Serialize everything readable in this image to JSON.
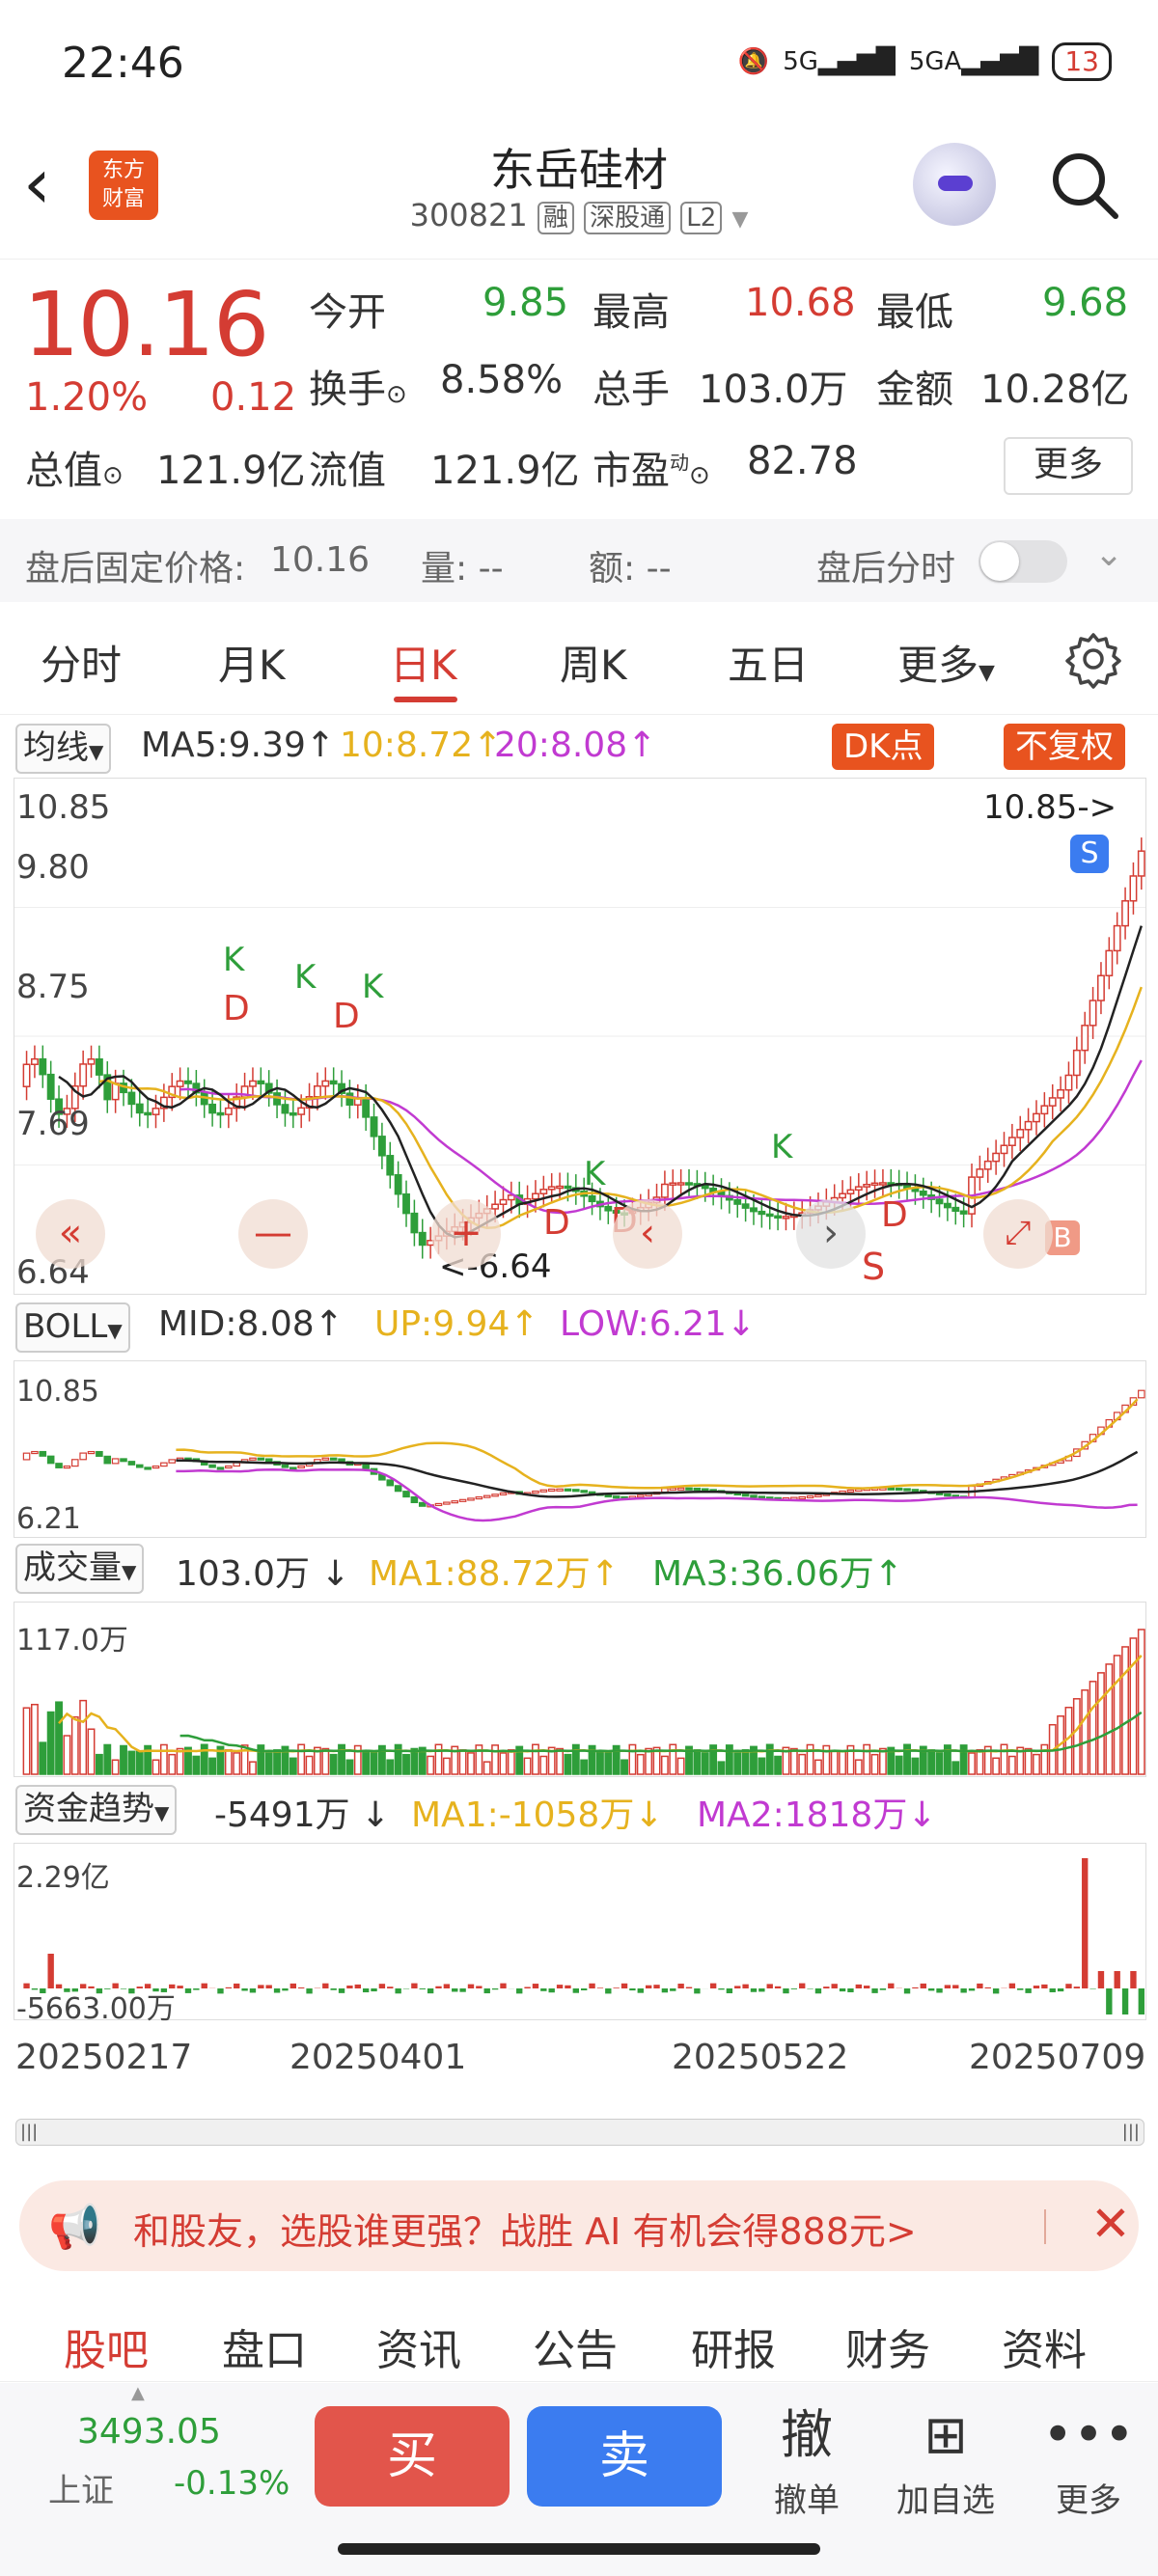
{
  "status_bar": {
    "time": "22:46",
    "network1": "5G",
    "network2": "5GA",
    "battery": "13"
  },
  "header": {
    "brand_logo_line1": "东方",
    "brand_logo_line2": "财富",
    "stock_name": "东岳硅材",
    "stock_code": "300821",
    "tags": [
      "融",
      "深股通",
      "L2"
    ]
  },
  "quote": {
    "price": "10.16",
    "change_pct": "1.20%",
    "change_amt": "0.12",
    "fields": {
      "open_label": "今开",
      "open_value": "9.85",
      "high_label": "最高",
      "high_value": "10.68",
      "low_label": "最低",
      "low_value": "9.68",
      "turnover_label": "换手",
      "turnover_value": "8.58%",
      "volume_label": "总手",
      "volume_value": "103.0万",
      "amount_label": "金额",
      "amount_value": "10.28亿",
      "mktcap_label": "总值",
      "mktcap_value": "121.9亿",
      "float_label": "流值",
      "float_value": "121.9亿",
      "pe_label": "市盈",
      "pe_sup": "动",
      "pe_value": "82.78"
    },
    "more_label": "更多"
  },
  "after_hours": {
    "price_label": "盘后固定价格:",
    "price_value": "10.16",
    "volume_label": "量: --",
    "amount_label": "额: --",
    "toggle_label": "盘后分时",
    "toggle_on": false
  },
  "period_tabs": [
    "分时",
    "月K",
    "日K",
    "周K",
    "五日",
    "更多"
  ],
  "period_active": "日K",
  "ma_row": {
    "selector": "均线",
    "ma5": "MA5:9.39",
    "ma10": "10:8.72",
    "ma20": "20:8.08",
    "dk_label": "DK点",
    "fq_label": "不复权"
  },
  "kline_labels": {
    "high": "10.85",
    "l2": "9.80",
    "l3": "8.75",
    "l4": "7.69",
    "low": "6.64",
    "high_marker": "10.85->",
    "low_marker": "<-6.64",
    "signal_k": "K",
    "signal_d": "D",
    "signal_s": "S",
    "signal_b": "B"
  },
  "boll_row": {
    "selector": "BOLL",
    "mid": "MID:8.08",
    "up": "UP:9.94",
    "low": "LOW:6.21",
    "axis_top": "10.85",
    "axis_bottom": "6.21"
  },
  "volume_row": {
    "selector": "成交量",
    "value": "103.0万",
    "ma1": "MA1:88.72万",
    "ma3": "MA3:36.06万",
    "axis_top": "117.0万"
  },
  "fund_row": {
    "selector": "资金趋势",
    "value": "-5491万",
    "ma1": "MA1:-1058万",
    "ma2": "MA2:1818万",
    "axis_top": "2.29亿",
    "axis_bottom": "-5663.00万"
  },
  "dates": [
    "20250217",
    "20250401",
    "20250522",
    "20250709"
  ],
  "colors": {
    "up": "#d43c33",
    "down": "#2e9e3a",
    "ma5": "#222222",
    "ma10": "#e6b21e",
    "ma20": "#c13ad1",
    "accent": "#e8531f"
  },
  "banner": {
    "text": "和股友，选股谁更强？战胜 AI 有机会得888元>"
  },
  "bottom_tabs": [
    "股吧",
    "盘口",
    "资讯",
    "公告",
    "研报",
    "财务",
    "资料"
  ],
  "bottom_active": "股吧",
  "trade_bar": {
    "index_value": "3493.05",
    "index_name": "上证",
    "index_pct": "-0.13%",
    "buy": "买",
    "sell": "卖",
    "cancel_icon": "撤",
    "cancel_label": "撤单",
    "watch_label": "加自选",
    "more_label": "更多"
  }
}
